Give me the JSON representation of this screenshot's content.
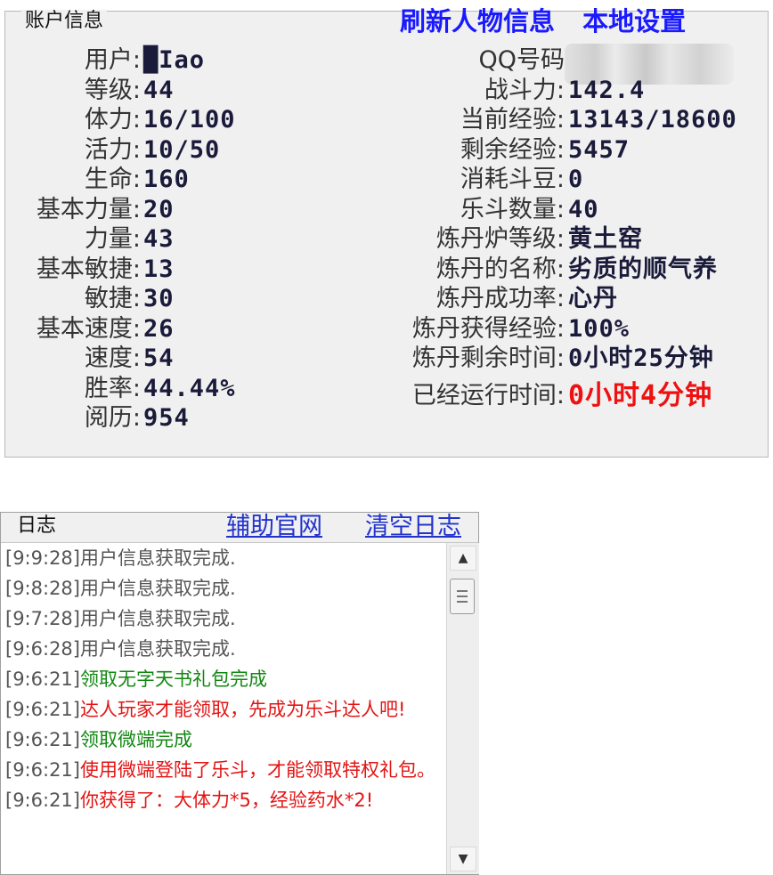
{
  "account": {
    "title": "账户信息",
    "links": [
      "刷新人物信息",
      "本地设置"
    ],
    "left_fields": [
      {
        "label": "用户:",
        "value": "█Iao"
      },
      {
        "label": "等级:",
        "value": "44"
      },
      {
        "label": "体力:",
        "value": "16/100"
      },
      {
        "label": "活力:",
        "value": "10/50"
      },
      {
        "label": "生命:",
        "value": "160"
      },
      {
        "label": "基本力量:",
        "value": "20"
      },
      {
        "label": "力量:",
        "value": "43"
      },
      {
        "label": "基本敏捷:",
        "value": "13"
      },
      {
        "label": "敏捷:",
        "value": "30"
      },
      {
        "label": "基本速度:",
        "value": "26"
      },
      {
        "label": "速度:",
        "value": "54"
      },
      {
        "label": "胜率:",
        "value": "44.44%"
      },
      {
        "label": "阅历:",
        "value": "954"
      }
    ],
    "right_fields": [
      {
        "label": "QQ号码",
        "value": ""
      },
      {
        "label": "战斗力:",
        "value": "142.4"
      },
      {
        "label": "当前经验:",
        "value": "13143/18600"
      },
      {
        "label": "剩余经验:",
        "value": "5457"
      },
      {
        "label": "消耗斗豆:",
        "value": "0"
      },
      {
        "label": "乐斗数量:",
        "value": "40"
      },
      {
        "label": "炼丹炉等级:",
        "value": "黄土窑"
      },
      {
        "label": "炼丹的名称:",
        "value": "劣质的顺气养"
      },
      {
        "label": "炼丹成功率:",
        "value": "心丹"
      },
      {
        "label": "炼丹获得经验:",
        "value": "100%"
      },
      {
        "label": "炼丹剩余时间:",
        "value": "0小时25分钟"
      },
      {
        "label": "已经运行时间:",
        "value": "0小时4分钟"
      }
    ]
  },
  "log": {
    "title": "日志",
    "links": [
      "辅助官网",
      "清空日志"
    ],
    "entries": [
      {
        "time": "[9:9:28]",
        "text": "用户信息获取完成.",
        "color": "gray"
      },
      {
        "time": "[9:8:28]",
        "text": "用户信息获取完成.",
        "color": "gray"
      },
      {
        "time": "[9:7:28]",
        "text": "用户信息获取完成.",
        "color": "gray"
      },
      {
        "time": "[9:6:28]",
        "text": "用户信息获取完成.",
        "color": "gray"
      },
      {
        "time": "[9:6:21]",
        "text": "领取无字天书礼包完成",
        "color": "green"
      },
      {
        "time": "[9:6:21]",
        "text": "达人玩家才能领取，先成为乐斗达人吧!",
        "color": "red"
      },
      {
        "time": "[9:6:21]",
        "text": "领取微端完成",
        "color": "green"
      },
      {
        "time": "[9:6:21]",
        "text": "使用微端登陆了乐斗，才能领取特权礼包。",
        "color": "red"
      },
      {
        "time": "[9:6:21]",
        "text": "你获得了：大体力*5，经验药水*2!",
        "color": "red"
      }
    ]
  },
  "colors": {
    "link_blue": "#1a1aff",
    "log_green": "#118811",
    "log_red": "#e31414",
    "highlight_red": "#ee1111"
  },
  "icons": {
    "scroll_up": "▲",
    "scroll_down": "▼"
  }
}
